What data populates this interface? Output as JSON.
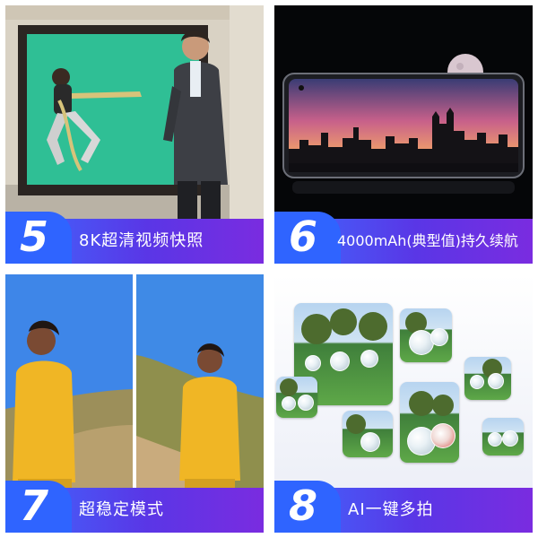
{
  "features": [
    {
      "number": "5",
      "label": "8K超清视频快照"
    },
    {
      "number": "6",
      "label": "4000mAh(典型值)持久续航"
    },
    {
      "number": "7",
      "label": "超稳定模式"
    },
    {
      "number": "8",
      "label": "AI一键多拍"
    }
  ],
  "colors": {
    "caption_start": "#3d6bff",
    "caption_end": "#7a2ce0",
    "badge": "#2f64ff",
    "text": "#ffffff"
  }
}
